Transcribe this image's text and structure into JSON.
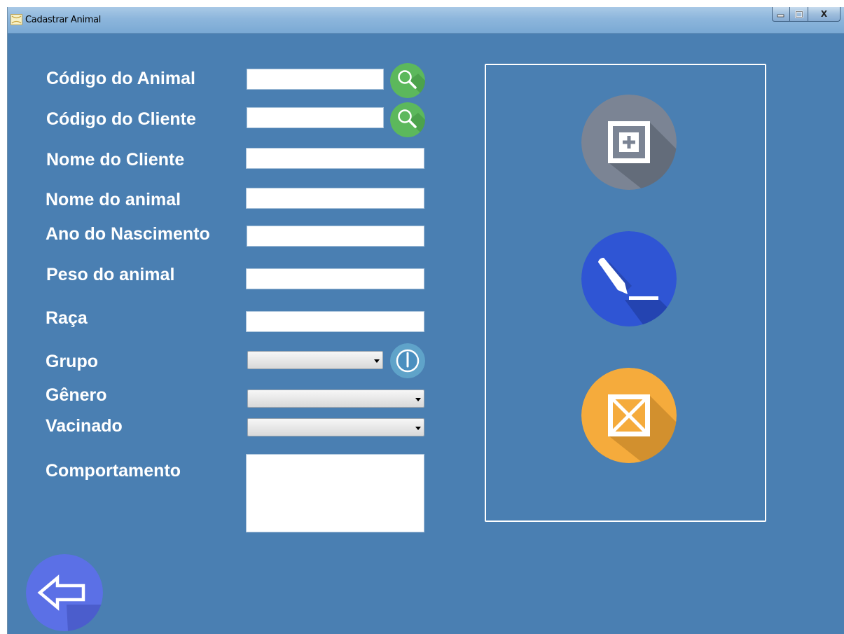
{
  "window": {
    "title": "Cadastrar Animal",
    "controls": {
      "minimize": "_",
      "maximize": "□",
      "close": "X"
    }
  },
  "form": {
    "codigo_animal_label": "Código do Animal",
    "codigo_cliente_label": "Código do Cliente",
    "nome_cliente_label": "Nome do Cliente",
    "nome_animal_label": "Nome do animal",
    "ano_nascimento_label": "Ano do Nascimento",
    "peso_label": "Peso do animal",
    "raca_label": "Raça",
    "grupo_label": "Grupo",
    "genero_label": "Gênero",
    "vacinado_label": "Vacinado",
    "comportamento_label": "Comportamento",
    "codigo_animal_value": "",
    "codigo_cliente_value": "",
    "nome_cliente_value": "",
    "nome_animal_value": "",
    "ano_nascimento_value": "",
    "peso_value": "",
    "raca_value": "",
    "grupo_value": "",
    "genero_value": "",
    "vacinado_value": "",
    "comportamento_value": ""
  },
  "icons": {
    "search": "search-icon",
    "power": "power-icon",
    "add": "add-icon",
    "edit": "pencil-icon",
    "delete": "delete-box-icon",
    "back": "back-arrow-icon"
  },
  "colors": {
    "background": "#4a7fb2",
    "search_green": "#5cb85c",
    "add_gray": "#7b8494",
    "edit_blue": "#2f55d4",
    "delete_orange": "#f5ab3c",
    "back_purple": "#5b70e6"
  }
}
